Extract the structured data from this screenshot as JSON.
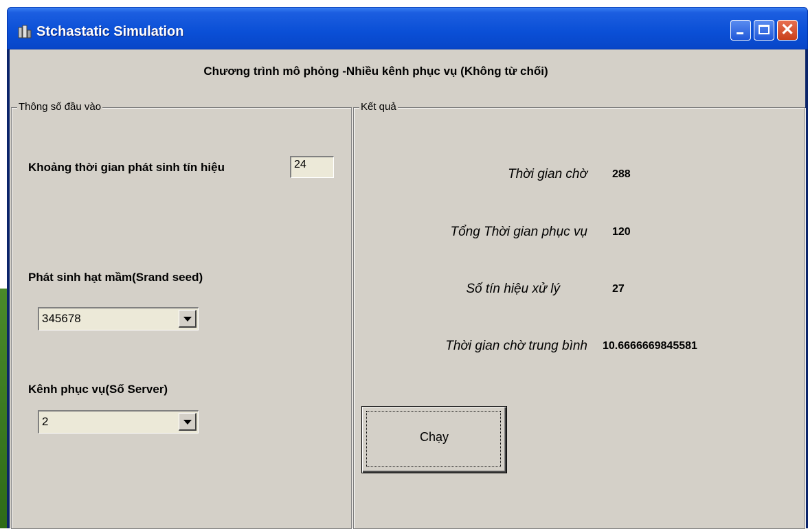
{
  "window": {
    "title": "Stchastatic Simulation",
    "controls": {
      "minimize": "minimize-icon",
      "maximize": "maximize-icon",
      "close": "close-icon"
    }
  },
  "heading": "Chương trình mô phỏng -Nhiều kênh phục vụ (Không từ chối)",
  "input_group": {
    "legend": "Thông số đầu vào",
    "interval_label": "Khoảng thời gian phát sinh tín hiệu",
    "interval_value": "24",
    "seed_label": "Phát sinh hạt mầm(Srand seed)",
    "seed_value": "345678",
    "servers_label": "Kênh phục vụ(Số Server)",
    "servers_value": "2"
  },
  "result_group": {
    "legend": "Kết quả",
    "wait_time_label": "Thời gian chờ",
    "wait_time_value": "288",
    "total_service_label": "Tổng Thời gian phục vụ",
    "total_service_value": "120",
    "signals_label": "Số tín hiệu xử lý",
    "signals_value": "27",
    "avg_wait_label": "Thời gian chờ trung bình",
    "avg_wait_value": "10.6666669845581"
  },
  "run_button": {
    "label": "Chạy"
  },
  "colors": {
    "titlebar": "#0a4fd6",
    "client": "#d4d0c8",
    "close_button": "#c8401c"
  }
}
